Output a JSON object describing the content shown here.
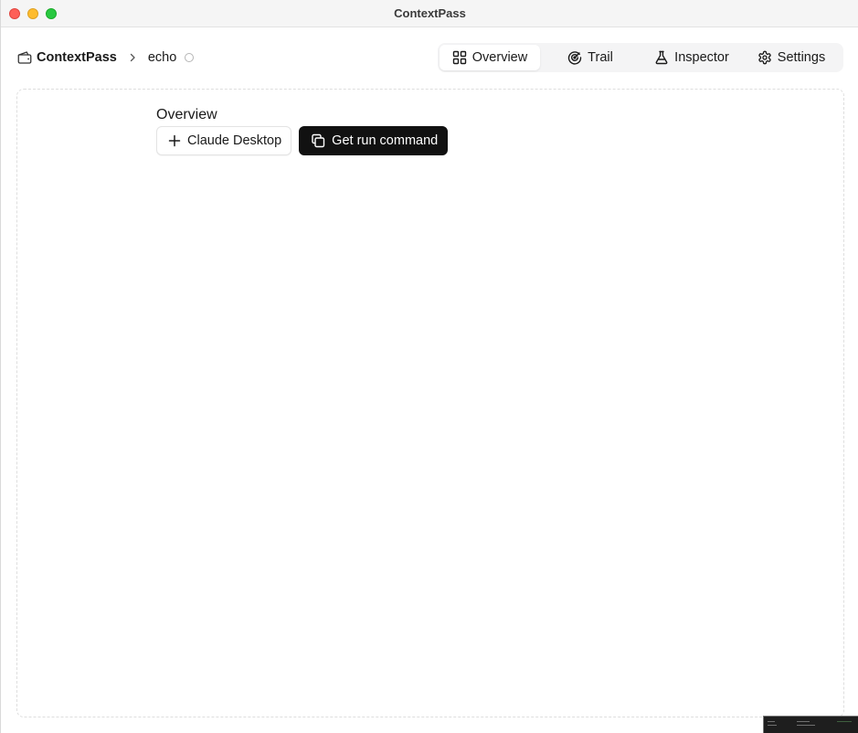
{
  "window": {
    "title": "ContextPass"
  },
  "breadcrumb": {
    "app_icon": "wallet-icon",
    "app_name": "ContextPass",
    "separator_icon": "chevron-right-icon",
    "server_name": "echo",
    "status_icon": "status-circle-icon"
  },
  "tabs": [
    {
      "label": "Overview",
      "icon": "layout-grid-icon",
      "active": true
    },
    {
      "label": "Trail",
      "icon": "radar-icon",
      "active": false
    },
    {
      "label": "Inspector",
      "icon": "flask-icon",
      "active": false
    },
    {
      "label": "Settings",
      "icon": "gear-icon",
      "active": false
    }
  ],
  "main": {
    "section_title": "Overview",
    "add_button": {
      "label": "Claude Desktop",
      "icon": "plus-icon"
    },
    "copy_button": {
      "label": "Get run command",
      "icon": "copy-icon"
    }
  },
  "colors": {
    "primary_button_bg": "#111111",
    "tab_strip_bg": "#f4f4f5",
    "close": "#fe5f57",
    "minimize": "#febc2e",
    "maximize": "#28c840"
  }
}
